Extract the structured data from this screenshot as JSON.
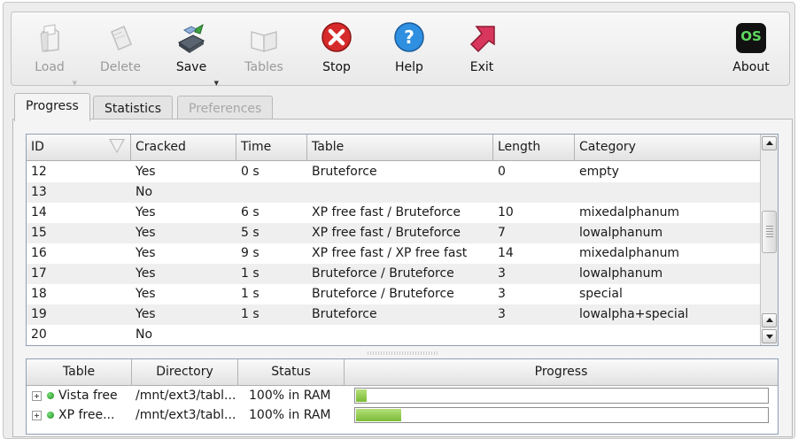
{
  "toolbar": {
    "load": "Load",
    "delete": "Delete",
    "save": "Save",
    "tables": "Tables",
    "stop": "Stop",
    "help": "Help",
    "exit": "Exit",
    "about": "About",
    "about_logo_text": "OS"
  },
  "tabs": [
    "Progress",
    "Statistics",
    "Preferences"
  ],
  "hash_table": {
    "columns": [
      "ID",
      "Cracked",
      "Time",
      "Table",
      "Length",
      "Category"
    ],
    "rows": [
      [
        "12",
        "Yes",
        "0 s",
        "Bruteforce",
        "0",
        "empty"
      ],
      [
        "13",
        "No",
        "",
        "",
        "",
        ""
      ],
      [
        "14",
        "Yes",
        "6 s",
        "XP free fast / Bruteforce",
        "10",
        "mixedalphanum"
      ],
      [
        "15",
        "Yes",
        "5 s",
        "XP free fast / Bruteforce",
        "7",
        "lowalphanum"
      ],
      [
        "16",
        "Yes",
        "9 s",
        "XP free fast / XP free fast",
        "14",
        "mixedalphanum"
      ],
      [
        "17",
        "Yes",
        "1 s",
        "Bruteforce / Bruteforce",
        "3",
        "lowalphanum"
      ],
      [
        "18",
        "Yes",
        "1 s",
        "Bruteforce / Bruteforce",
        "3",
        "special"
      ],
      [
        "19",
        "Yes",
        "1 s",
        "Bruteforce",
        "3",
        "lowalpha+special"
      ],
      [
        "20",
        "No",
        "",
        "",
        "",
        ""
      ]
    ]
  },
  "tables_panel": {
    "columns": [
      "Table",
      "Directory",
      "Status",
      "Progress"
    ],
    "rows": [
      {
        "table": "Vista free",
        "directory": "/mnt/ext3/tabl...",
        "status": "100% in RAM",
        "progress": 0.025
      },
      {
        "table": "XP free...",
        "directory": "/mnt/ext3/tabl...",
        "status": "100% in RAM",
        "progress": 0.11
      }
    ]
  },
  "colors": {
    "stop_red": "#d62b2b",
    "help_blue": "#2f8fe0",
    "exit_pink": "#d8365c",
    "progress_green": "#8cc94a",
    "about_bg": "#111111",
    "about_text": "#5fd85f"
  }
}
